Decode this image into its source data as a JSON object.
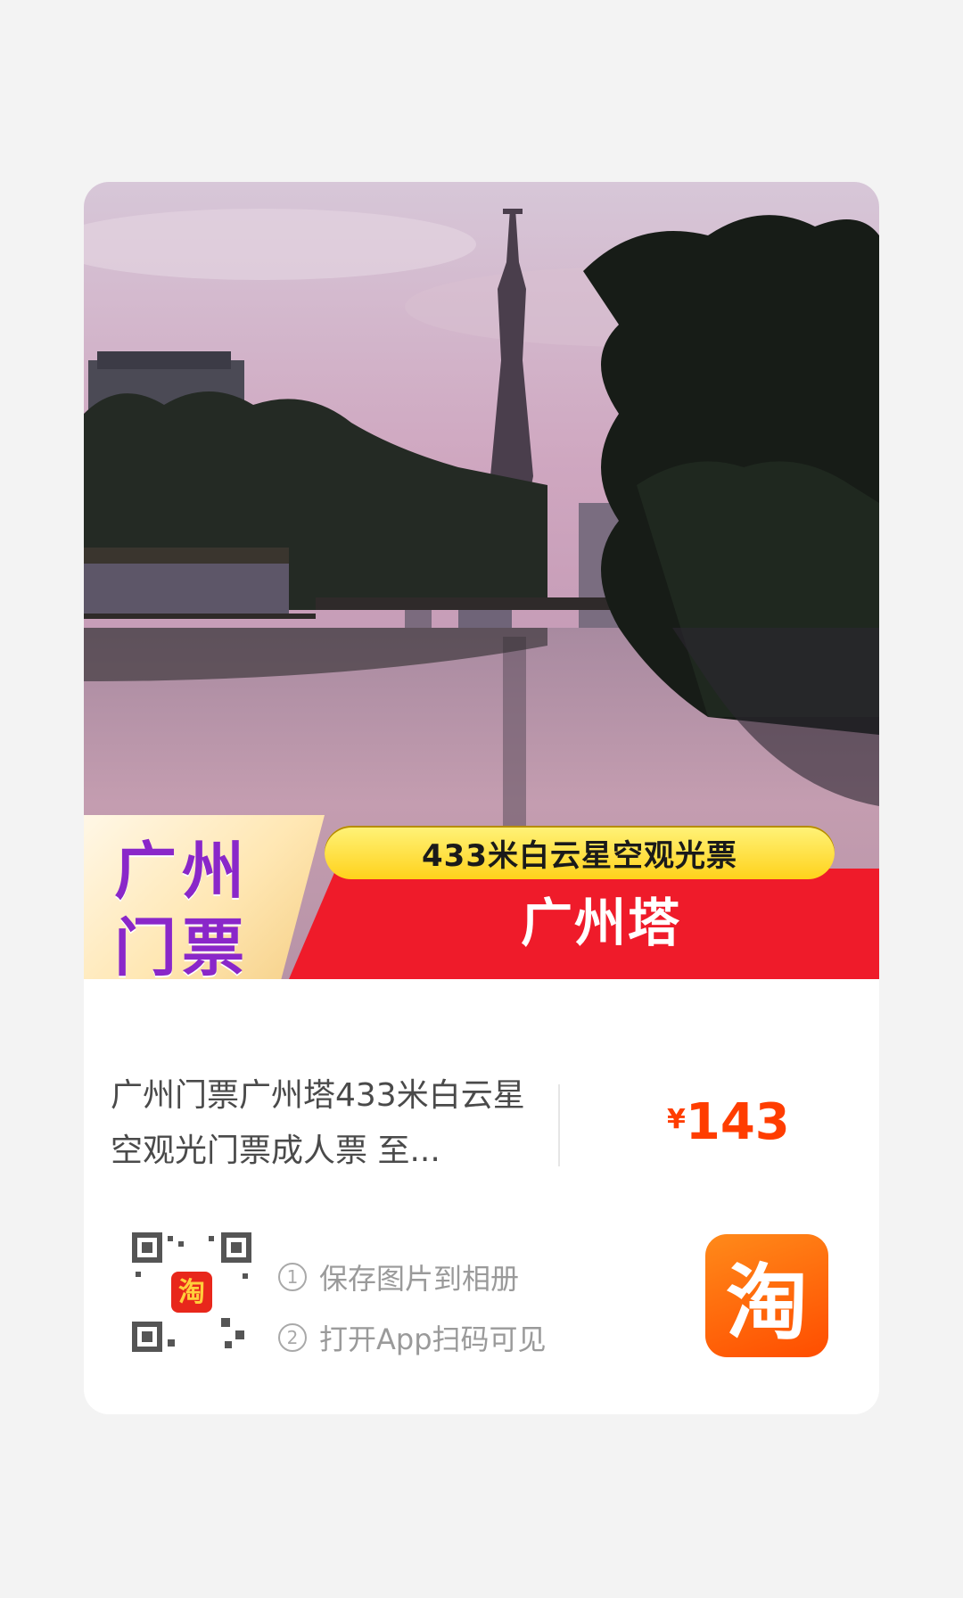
{
  "banner": {
    "badge": "广州 门票",
    "subtitle": "433米白云星空观光票",
    "title": "广州塔"
  },
  "product": {
    "title": "广州门票广州塔433米白云星空观光门票成人票 至...",
    "price_symbol": "¥",
    "price_value": "143"
  },
  "steps": [
    {
      "num": "1",
      "text": "保存图片到相册"
    },
    {
      "num": "2",
      "text": "打开App扫码可见"
    }
  ],
  "app_icon_text": "淘",
  "colors": {
    "price": "#ff3d00",
    "red_banner": "#ef1b2a",
    "yellow_banner": "#ffd21b",
    "badge_text": "#8a27c9",
    "taobao": "#ff5a00"
  },
  "icons": {
    "qr": "qr-code-icon",
    "app": "taobao-app-icon",
    "step": "circled-number-icon"
  }
}
